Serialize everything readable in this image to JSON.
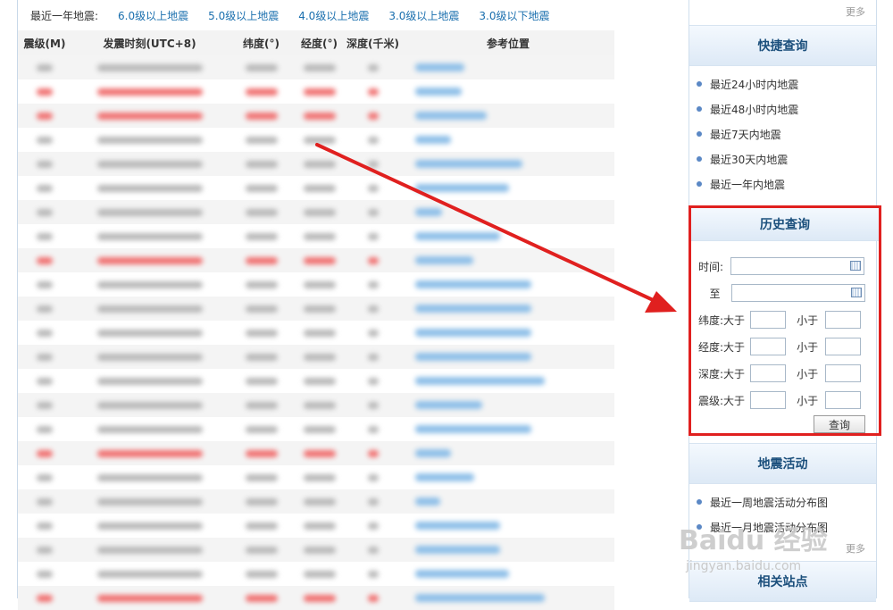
{
  "filter_bar": {
    "label": "最近一年地震:",
    "links": [
      "6.0级以上地震",
      "5.0级以上地震",
      "4.0级以上地震",
      "3.0级以上地震",
      "3.0级以下地震"
    ]
  },
  "table": {
    "headers": [
      "震级(M)",
      "发震时刻(UTC+8)",
      "纬度(°)",
      "经度(°)",
      "深度(千米)",
      "参考位置"
    ],
    "rows": [
      {
        "tone": "gray",
        "loc": 0.55
      },
      {
        "tone": "red",
        "loc": 0.52
      },
      {
        "tone": "red",
        "loc": 0.8
      },
      {
        "tone": "gray",
        "loc": 0.4
      },
      {
        "tone": "gray",
        "loc": 1.2
      },
      {
        "tone": "gray",
        "loc": 1.05
      },
      {
        "tone": "gray",
        "loc": 0.3
      },
      {
        "tone": "gray",
        "loc": 0.95
      },
      {
        "tone": "red",
        "loc": 0.65
      },
      {
        "tone": "gray",
        "loc": 1.3
      },
      {
        "tone": "gray",
        "loc": 1.3
      },
      {
        "tone": "gray",
        "loc": 1.3
      },
      {
        "tone": "gray",
        "loc": 1.3
      },
      {
        "tone": "gray",
        "loc": 1.45
      },
      {
        "tone": "gray",
        "loc": 0.75
      },
      {
        "tone": "gray",
        "loc": 1.3
      },
      {
        "tone": "red",
        "loc": 0.4
      },
      {
        "tone": "gray",
        "loc": 0.66
      },
      {
        "tone": "gray",
        "loc": 0.28
      },
      {
        "tone": "gray",
        "loc": 0.95
      },
      {
        "tone": "gray",
        "loc": 0.95
      },
      {
        "tone": "gray",
        "loc": 1.05
      },
      {
        "tone": "red",
        "loc": 1.45
      }
    ]
  },
  "sidebar": {
    "more_label": "更多",
    "quick": {
      "title": "快捷查询",
      "items": [
        "最近24小时内地震",
        "最近48小时内地震",
        "最近7天内地震",
        "最近30天内地震",
        "最近一年内地震"
      ]
    },
    "history": {
      "title": "历史查询",
      "time_label": "时间:",
      "to_label": "至",
      "rows": [
        {
          "label": "纬度:",
          "gt": "大于",
          "lt": "小于"
        },
        {
          "label": "经度:",
          "gt": "大于",
          "lt": "小于"
        },
        {
          "label": "深度:",
          "gt": "大于",
          "lt": "小于"
        },
        {
          "label": "震级:",
          "gt": "大于",
          "lt": "小于"
        }
      ],
      "button": "查询"
    },
    "activity": {
      "title": "地震活动",
      "items": [
        "最近一周地震活动分布图",
        "最近一月地震活动分布图"
      ]
    },
    "related": {
      "title": "相关站点"
    }
  },
  "watermark": {
    "brand": "Baidu 经验",
    "url": "jingyan.baidu.com"
  },
  "colors": {
    "accent_red": "#e0201f",
    "link_blue": "#1a6fae",
    "panel_title": "#1b4f7c"
  }
}
